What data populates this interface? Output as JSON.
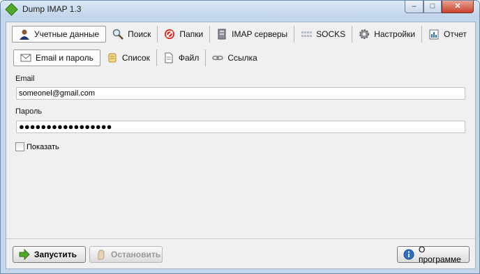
{
  "window": {
    "title": "Dump IMAP 1.3",
    "controls": {
      "minimize": "–",
      "maximize": "□",
      "close": "✕"
    }
  },
  "main_tabs": [
    {
      "label": "Учетные данные",
      "icon": "user-icon",
      "active": true
    },
    {
      "label": "Поиск",
      "icon": "search-icon"
    },
    {
      "label": "Папки",
      "icon": "stop-sign-icon"
    },
    {
      "label": "IMAP серверы",
      "icon": "server-icon"
    },
    {
      "label": "SOCKS",
      "icon": "socks-icon"
    },
    {
      "label": "Настройки",
      "icon": "gear-icon"
    },
    {
      "label": "Отчет",
      "icon": "report-icon"
    }
  ],
  "sub_tabs": [
    {
      "label": "Email и пароль",
      "icon": "envelope-icon",
      "active": true
    },
    {
      "label": "Список",
      "icon": "scroll-icon"
    },
    {
      "label": "Файл",
      "icon": "file-icon"
    },
    {
      "label": "Ссылка",
      "icon": "link-icon"
    }
  ],
  "form": {
    "email_label": "Email",
    "email_value": "someonel@gmail.com",
    "password_label": "Пароль",
    "password_value": "●●●●●●●●●●●●●●●●●",
    "show_label": "Показать"
  },
  "buttons": {
    "run": "Запустить",
    "stop": "Остановить",
    "about": "О программе"
  },
  "colors": {
    "accent_green": "#52a82a",
    "stop_red": "#d9251d",
    "info_blue": "#2f6fc2"
  }
}
